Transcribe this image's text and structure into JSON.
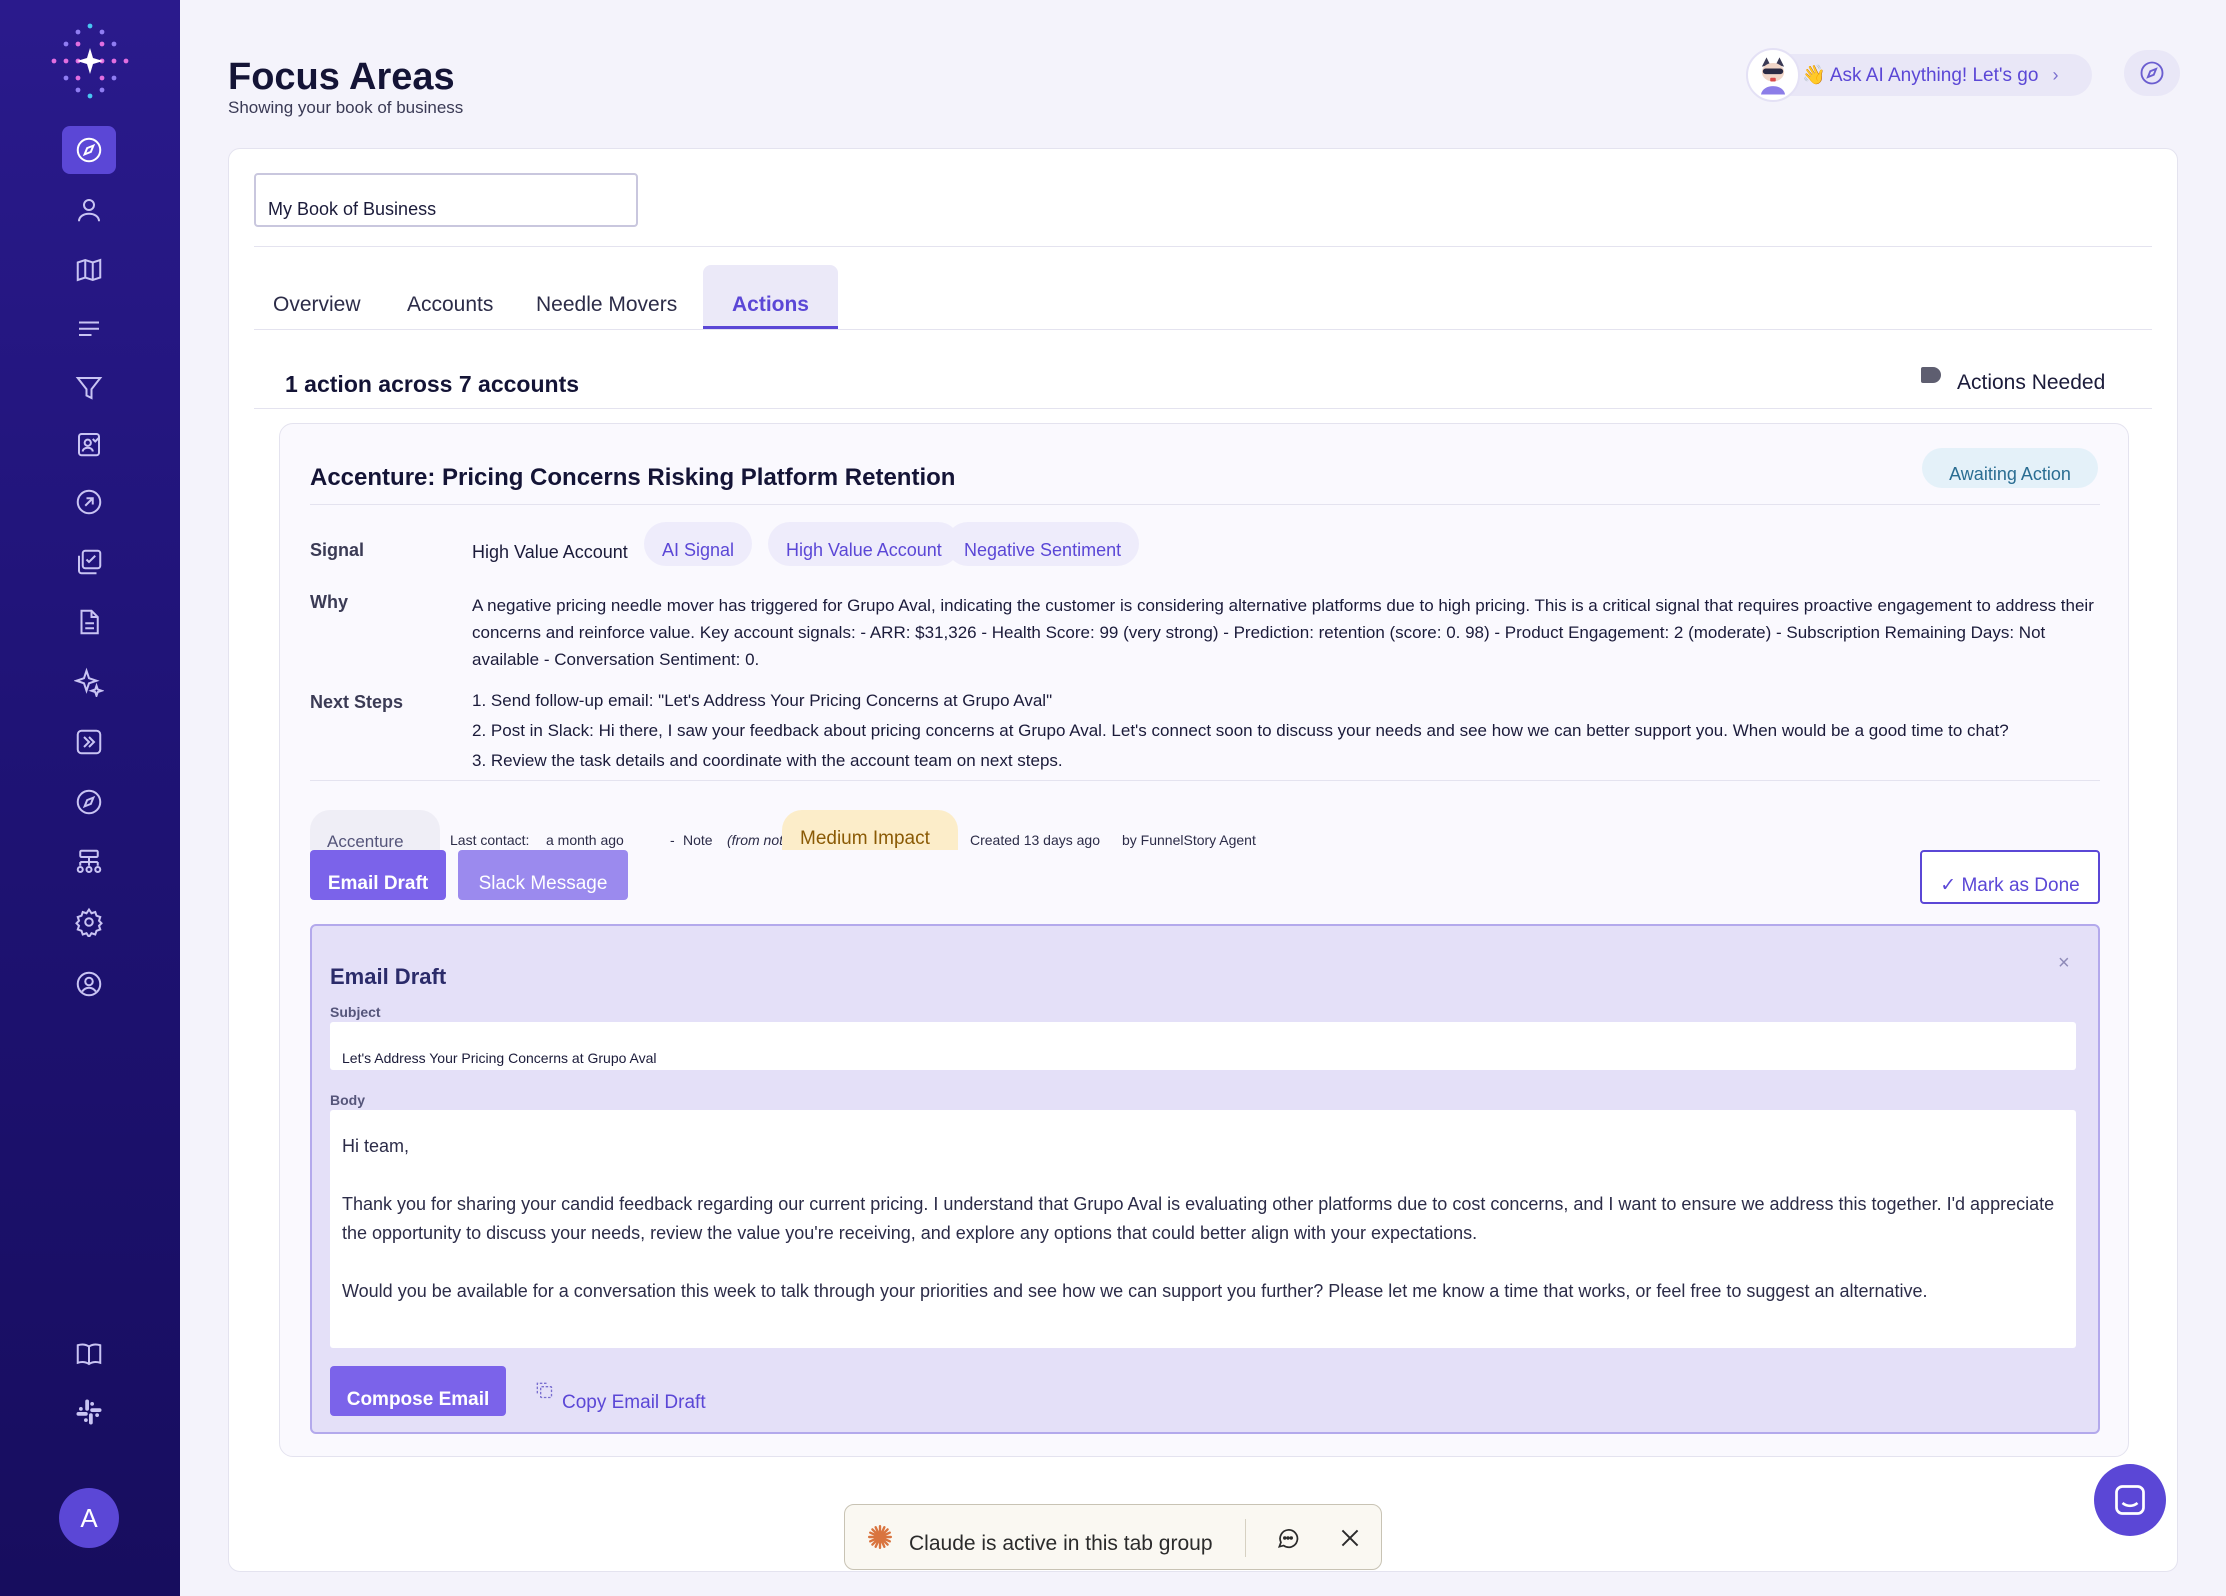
{
  "sidebar": {
    "items": [
      {
        "name": "sidebar-item-focus-areas",
        "icon": "compass-icon",
        "active": true
      },
      {
        "name": "sidebar-item-people",
        "icon": "user-icon"
      },
      {
        "name": "sidebar-item-map",
        "icon": "map-icon"
      },
      {
        "name": "sidebar-item-list",
        "icon": "lines-icon"
      },
      {
        "name": "sidebar-item-filter",
        "icon": "funnel-icon"
      },
      {
        "name": "sidebar-item-reports",
        "icon": "clipboard-user-icon"
      },
      {
        "name": "sidebar-item-goto",
        "icon": "arrow-circle-icon"
      },
      {
        "name": "sidebar-item-tasks",
        "icon": "checklist-icon"
      },
      {
        "name": "sidebar-item-docs",
        "icon": "document-icon"
      },
      {
        "name": "sidebar-item-ai",
        "icon": "sparkle-icon"
      },
      {
        "name": "sidebar-item-forward",
        "icon": "forward-icon"
      },
      {
        "name": "sidebar-item-explore",
        "icon": "compass-icon"
      },
      {
        "name": "sidebar-item-hierarchy",
        "icon": "hierarchy-icon"
      },
      {
        "name": "sidebar-item-settings",
        "icon": "gear-icon"
      },
      {
        "name": "sidebar-item-account",
        "icon": "user-circle-icon"
      }
    ],
    "bottom": [
      {
        "name": "sidebar-item-guide",
        "icon": "book-icon"
      },
      {
        "name": "sidebar-item-slack",
        "icon": "slack-icon"
      }
    ],
    "avatar_initial": "A"
  },
  "header": {
    "title": "Focus Areas",
    "subtitle": "Showing your book of business",
    "ask_ai": "👋 Ask AI Anything! Let's go",
    "ask_ai_chevron": "›"
  },
  "filter": {
    "book_value": "My Book of Business"
  },
  "tabs": [
    {
      "label": "Overview",
      "active": false
    },
    {
      "label": "Accounts",
      "active": false
    },
    {
      "label": "Needle Movers",
      "active": false
    },
    {
      "label": "Actions",
      "active": true
    }
  ],
  "summary": {
    "count_text": "1 action across 7 accounts",
    "filter_label": "Actions Needed"
  },
  "action": {
    "title": "Accenture: Pricing Concerns Risking Platform Retention",
    "status": "Awaiting Action",
    "signal_label": "Signal",
    "signal_text": "High Value Account",
    "chips": [
      "AI Signal",
      "High Value Account",
      "Negative Sentiment"
    ],
    "why_label": "Why",
    "why_text": "A negative pricing needle mover has triggered for Grupo Aval, indicating the customer is considering alternative platforms due to high pricing. This is a critical signal that requires proactive engagement to address their concerns and reinforce value. Key account signals: - ARR: $31,326 - Health Score: 99 (very strong) - Prediction: retention (score: 0. 98) - Product Engagement: 2 (moderate) - Subscription Remaining Days: Not available - Conversation Sentiment: 0.",
    "next_steps_label": "Next Steps",
    "next_steps": [
      "1. Send follow-up email: \"Let's Address Your Pricing Concerns at Grupo Aval\"",
      "2. Post in Slack: Hi there, I saw your feedback about pricing concerns at Grupo Aval. Let's connect soon to discuss your needs and see how we can better support you. When would be a good time to chat?",
      "3. Review the task details and coordinate with the account team on next steps."
    ],
    "meta": {
      "account": "Accenture",
      "last_contact_label": "Last contact:",
      "last_contact_value": "a month ago",
      "dash": "-",
      "source": "Note",
      "source_note": "(from note)",
      "impact": "Medium Impact",
      "created": "Created 13 days ago",
      "by": "by FunnelStory Agent"
    },
    "buttons": {
      "email_draft": "Email Draft",
      "slack_message": "Slack Message",
      "mark_done": "✓ Mark as Done"
    }
  },
  "draft": {
    "title": "Email Draft",
    "close": "×",
    "subject_label": "Subject",
    "subject_value": "Let's Address Your Pricing Concerns at Grupo Aval",
    "body_label": "Body",
    "body_paragraphs": [
      "Hi team,",
      "Thank you for sharing your candid feedback regarding our current pricing. I understand that Grupo Aval is evaluating other platforms due to cost concerns, and I want to ensure we address this together. I'd appreciate the opportunity to discuss your needs, review the value you're receiving, and explore any options that could better align with your expectations.",
      "Would you be available for a conversation this week to talk through your priorities and see how we can support you further? Please let me know a time that works, or feel free to suggest an alternative."
    ],
    "compose_button": "Compose Email",
    "copy_button": "Copy Email Draft"
  },
  "claude_bar": {
    "text": "Claude is active in this tab group"
  },
  "colors": {
    "accent": "#5b47d6",
    "sidebar": "#1f1376",
    "impact_bg": "#fcedc9",
    "status_bg": "#e4f1f9"
  }
}
